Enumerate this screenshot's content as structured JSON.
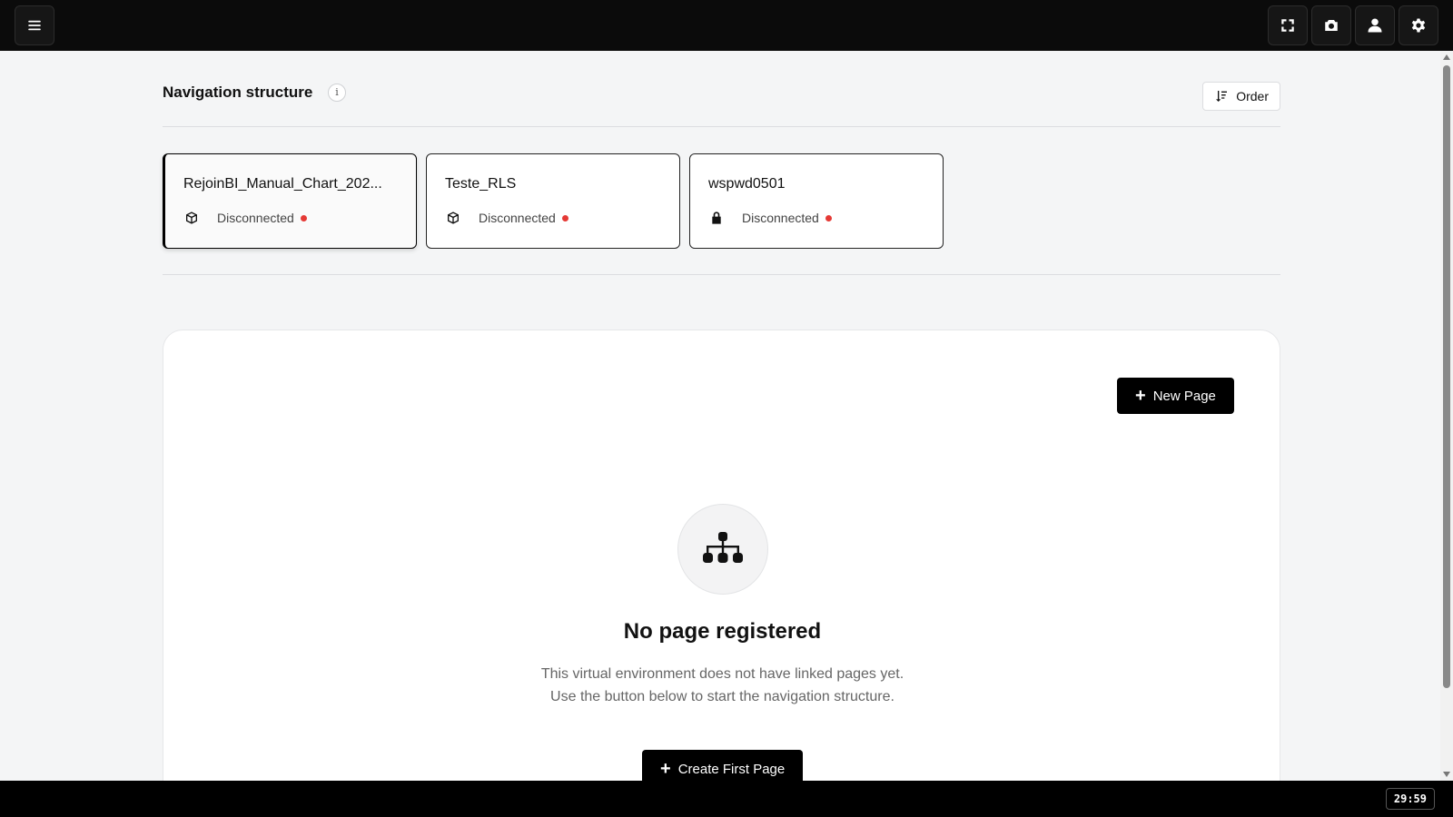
{
  "topbar": {
    "menu_icon": "hamburger-menu-icon",
    "actions": [
      {
        "icon": "fullscreen-icon"
      },
      {
        "icon": "camera-icon"
      },
      {
        "icon": "user-icon"
      },
      {
        "icon": "gear-icon"
      }
    ]
  },
  "header": {
    "title": "Navigation structure",
    "info_label": "i",
    "order_label": "Order"
  },
  "environments": [
    {
      "name": "RejoinBI_Manual_Chart_202...",
      "icon": "cube-icon",
      "status": "Disconnected",
      "selected": true
    },
    {
      "name": "Teste_RLS",
      "icon": "cube-icon",
      "status": "Disconnected",
      "selected": false
    },
    {
      "name": "wspwd0501",
      "icon": "lock-icon",
      "status": "Disconnected",
      "selected": false
    }
  ],
  "panel": {
    "new_page_label": "New Page",
    "plus_symbol": "+",
    "empty_icon": "sitemap-icon",
    "empty_title": "No page registered",
    "empty_desc_line1": "This virtual environment does not have linked pages yet.",
    "empty_desc_line2": "Use the button below to start the navigation structure.",
    "create_label": "Create First Page"
  },
  "timer": "29:59",
  "colors": {
    "status_disconnected": "#e53935",
    "primary_button": "#000000",
    "topbar": "#0b0b0b"
  }
}
